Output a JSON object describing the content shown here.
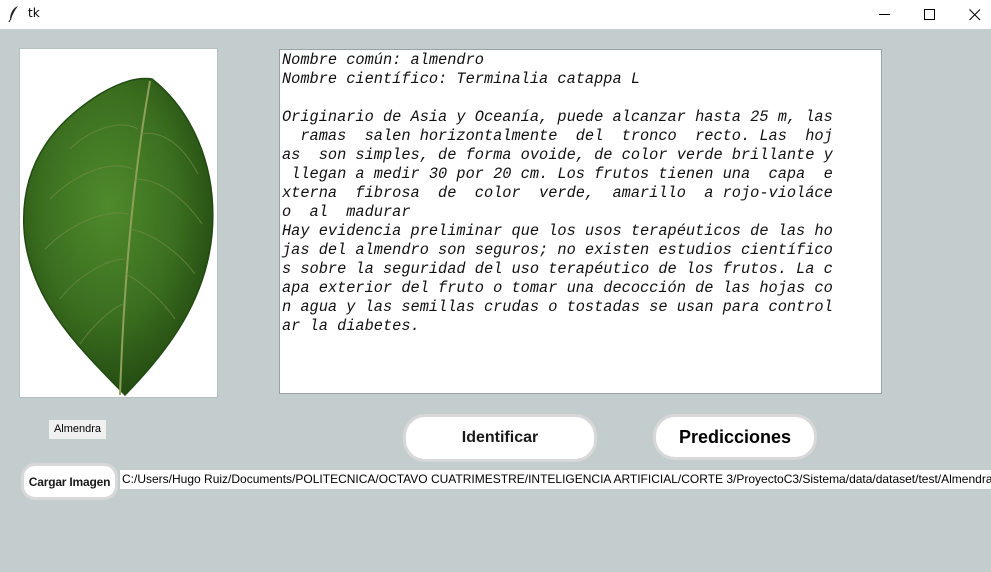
{
  "window": {
    "title": "tk"
  },
  "plant": {
    "image_label": "Almendra",
    "description_lines": [
      "Nombre común: almendro",
      "Nombre científico: Terminalia catappa L",
      "",
      "Originario de Asia y Oceanía, puede alcanzar hasta 25 m, las",
      "  ramas  salen horizontalmente  del  tronco  recto. Las  hoj",
      "as  son simples, de forma ovoide, de color verde brillante y",
      " llegan a medir 30 por 20 cm. Los frutos tienen una  capa  e",
      "xterna  fibrosa  de  color  verde,  amarillo  a rojo-violáce",
      "o  al  madurar",
      "Hay evidencia preliminar que los usos terapéuticos de las ho",
      "jas del almendro son seguros; no existen estudios científico",
      "s sobre la seguridad del uso terapéutico de los frutos. La c",
      "apa exterior del fruto o tomar una decocción de las hojas co",
      "n agua y las semillas crudas o tostadas se usan para control",
      "ar la diabetes."
    ]
  },
  "buttons": {
    "identify": "Identificar",
    "predictions": "Predicciones",
    "load_image": "Cargar Imagen"
  },
  "file_path": "C:/Users/Hugo Ruiz/Documents/POLITECNICA/OCTAVO CUATRIMESTRE/INTELIGENCIA ARTIFICIAL/CORTE 3/ProyectoC3/Sistema/data/dataset/test/Almendra/Almendra",
  "icons": {
    "app": "feather-icon",
    "minimize": "minimize-icon",
    "maximize": "maximize-icon",
    "close": "close-icon"
  }
}
